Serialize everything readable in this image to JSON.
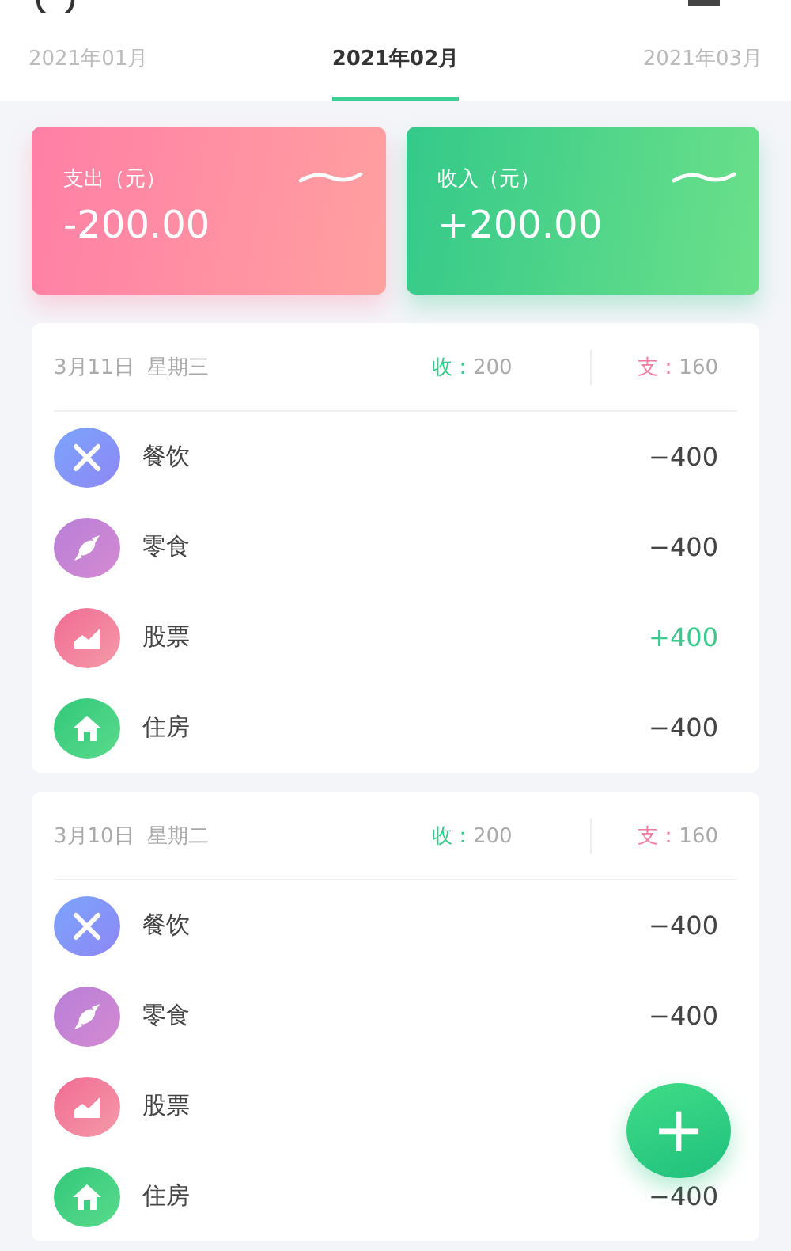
{
  "tabs": [
    {
      "label": "2021年01月",
      "selected": false
    },
    {
      "label": "2021年02月",
      "selected": true
    },
    {
      "label": "2021年03月",
      "selected": false
    }
  ],
  "summary": [
    {
      "kind": "expense",
      "label": "支出（元）",
      "amount": "-200.00"
    },
    {
      "kind": "income",
      "label": "收入（元）",
      "amount": "+200.00"
    }
  ],
  "days": [
    {
      "date": "3月11日",
      "weekday": "星期三",
      "income_label": "收：",
      "income": "200",
      "expense_label": "支：",
      "expense": "160",
      "entries": [
        {
          "kind": "food",
          "name": "餐饮",
          "income": false,
          "amount": "−400"
        },
        {
          "kind": "snack",
          "name": "零食",
          "income": false,
          "amount": "−400"
        },
        {
          "kind": "stock",
          "name": "股票",
          "income": true,
          "amount": "+400"
        },
        {
          "kind": "housing",
          "name": "住房",
          "income": false,
          "amount": "−400"
        }
      ]
    },
    {
      "date": "3月10日",
      "weekday": "星期二",
      "income_label": "收：",
      "income": "200",
      "expense_label": "支：",
      "expense": "160",
      "entries": [
        {
          "kind": "food",
          "name": "餐饮",
          "income": false,
          "amount": "−400"
        },
        {
          "kind": "snack",
          "name": "零食",
          "income": false,
          "amount": "−400"
        },
        {
          "kind": "stock",
          "name": "股票"
        },
        {
          "kind": "housing",
          "name": "住房",
          "income": false,
          "amount": "−400"
        }
      ]
    }
  ],
  "fab": {
    "symbol": "+"
  }
}
